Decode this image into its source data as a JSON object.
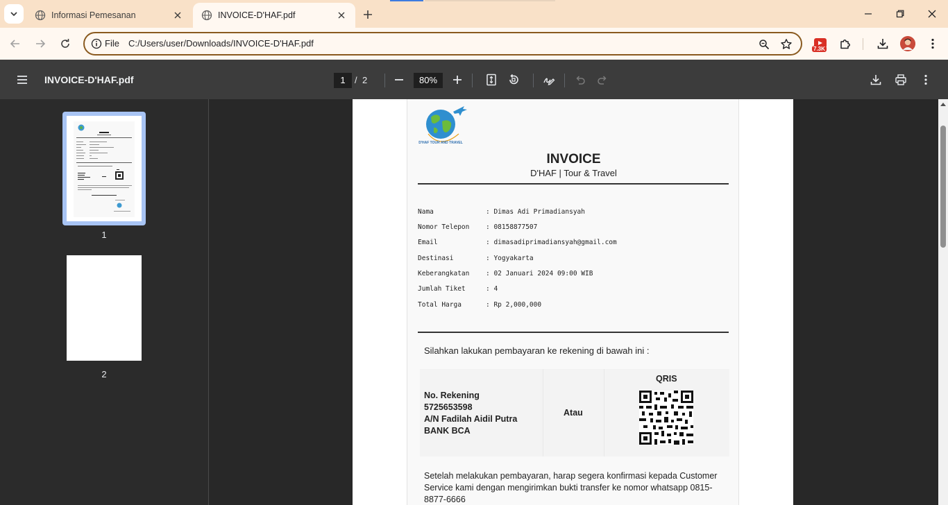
{
  "tabs": [
    {
      "title": "Informasi Pemesanan",
      "active": false
    },
    {
      "title": "INVOICE-D'HAF.pdf",
      "active": true
    }
  ],
  "address_bar": {
    "scheme": "File",
    "url": "C:/Users/user/Downloads/INVOICE-D'HAF.pdf"
  },
  "extension_badge": "7.3K",
  "pdf_toolbar": {
    "title": "INVOICE-D'HAF.pdf",
    "current_page": "1",
    "separator": "/",
    "total_pages": "2",
    "zoom": "80%"
  },
  "thumbnails": [
    {
      "label": "1"
    },
    {
      "label": "2"
    }
  ],
  "invoice": {
    "logo_text": "D'HAF TOUR AND TRAVEL",
    "title": "INVOICE",
    "subtitle": "D'HAF | Tour & Travel",
    "fields": [
      {
        "label": "Nama",
        "value": ": Dimas Adi Primadiansyah"
      },
      {
        "label": "Nomor Telepon",
        "value": ": 08158877507"
      },
      {
        "label": "Email",
        "value": ": dimasadiprimadiansyah@gmail.com"
      },
      {
        "label": "Destinasi",
        "value": ": Yogyakarta"
      },
      {
        "label": "Keberangkatan",
        "value": ": 02 Januari 2024 09:00 WIB"
      },
      {
        "label": "Jumlah Tiket",
        "value": ": 4"
      },
      {
        "label": "Total Harga",
        "value": ": Rp 2,000,000"
      }
    ],
    "payment_intro": "Silahkan lakukan pembayaran ke rekening di bawah ini :",
    "bank": {
      "line1": "No. Rekening",
      "line2": "5725653598",
      "line3": "A/N Fadilah Aidil Putra",
      "line4": "BANK BCA"
    },
    "or_label": "Atau",
    "qris_label": "QRIS",
    "after_payment": "Setelah melakukan pembayaran, harap segera konfirmasi kepada Customer Service kami dengan mengirimkan bukti transfer ke nomor whatsapp 0815-8877-6666"
  },
  "colors": {
    "tabstrip": "#f9e1c8",
    "toolbar": "#fff8f1",
    "pdf_toolbar": "#3c3c3c",
    "viewer_bg": "#282828",
    "thumb_selected": "#a8c4f4",
    "omnibox_border": "#8a5a1f"
  }
}
